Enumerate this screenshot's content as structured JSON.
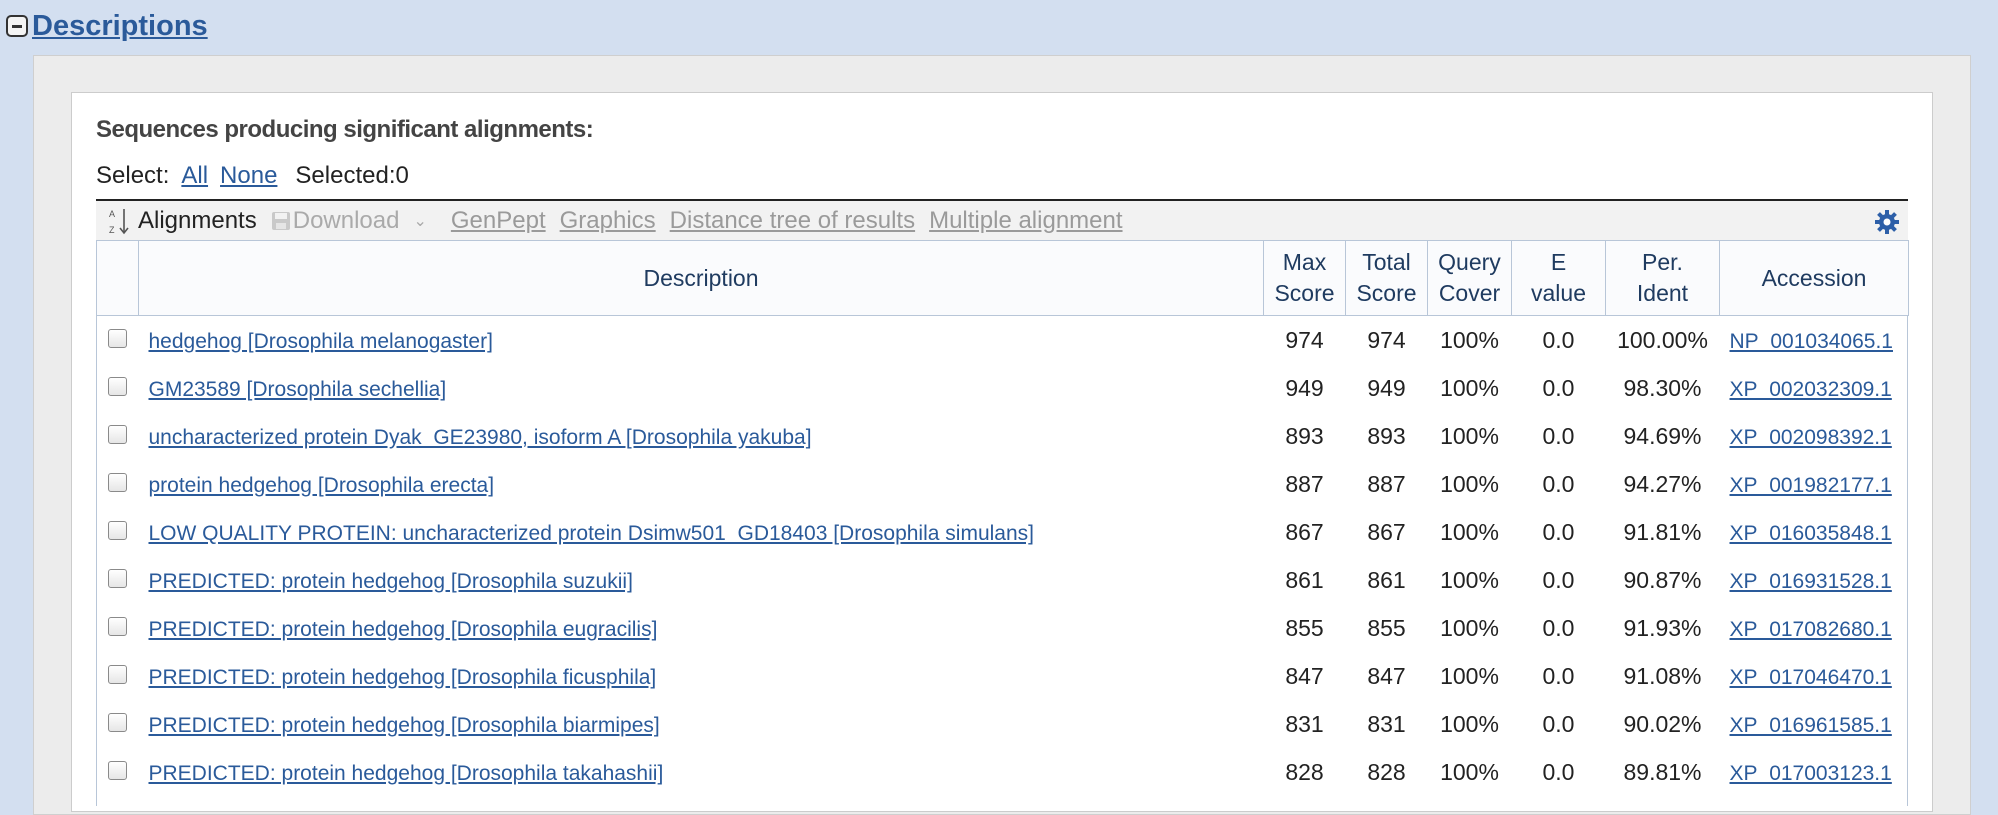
{
  "section": {
    "title": "Descriptions"
  },
  "heading": "Sequences producing significant alignments:",
  "select": {
    "label": "Select:",
    "all": "All",
    "none": "None",
    "selected": "Selected:0"
  },
  "toolbar": {
    "alignments": "Alignments",
    "download": "Download",
    "genpept": "GenPept",
    "graphics": "Graphics",
    "distance_tree": "Distance tree of results",
    "multiple_alignment": "Multiple alignment"
  },
  "columns": {
    "description": "Description",
    "max_score": [
      "Max",
      "Score"
    ],
    "total_score": [
      "Total",
      "Score"
    ],
    "query_cover": [
      "Query",
      "Cover"
    ],
    "e_value": [
      "E",
      "value"
    ],
    "per_ident": [
      "Per.",
      "Ident"
    ],
    "accession": "Accession"
  },
  "rows": [
    {
      "description": "hedgehog [Drosophila melanogaster]",
      "max": "974",
      "total": "974",
      "cover": "100%",
      "evalue": "0.0",
      "ident": "100.00%",
      "accession": "NP_001034065.1"
    },
    {
      "description": "GM23589 [Drosophila sechellia]",
      "max": "949",
      "total": "949",
      "cover": "100%",
      "evalue": "0.0",
      "ident": "98.30%",
      "accession": "XP_002032309.1"
    },
    {
      "description": "uncharacterized protein Dyak_GE23980, isoform A [Drosophila yakuba]",
      "max": "893",
      "total": "893",
      "cover": "100%",
      "evalue": "0.0",
      "ident": "94.69%",
      "accession": "XP_002098392.1"
    },
    {
      "description": "protein hedgehog [Drosophila erecta]",
      "max": "887",
      "total": "887",
      "cover": "100%",
      "evalue": "0.0",
      "ident": "94.27%",
      "accession": "XP_001982177.1"
    },
    {
      "description": "LOW QUALITY PROTEIN: uncharacterized protein Dsimw501_GD18403 [Drosophila simulans]",
      "max": "867",
      "total": "867",
      "cover": "100%",
      "evalue": "0.0",
      "ident": "91.81%",
      "accession": "XP_016035848.1"
    },
    {
      "description": "PREDICTED: protein hedgehog [Drosophila suzukii]",
      "max": "861",
      "total": "861",
      "cover": "100%",
      "evalue": "0.0",
      "ident": "90.87%",
      "accession": "XP_016931528.1"
    },
    {
      "description": "PREDICTED: protein hedgehog [Drosophila eugracilis]",
      "max": "855",
      "total": "855",
      "cover": "100%",
      "evalue": "0.0",
      "ident": "91.93%",
      "accession": "XP_017082680.1"
    },
    {
      "description": "PREDICTED: protein hedgehog [Drosophila ficusphila]",
      "max": "847",
      "total": "847",
      "cover": "100%",
      "evalue": "0.0",
      "ident": "91.08%",
      "accession": "XP_017046470.1"
    },
    {
      "description": "PREDICTED: protein hedgehog [Drosophila biarmipes]",
      "max": "831",
      "total": "831",
      "cover": "100%",
      "evalue": "0.0",
      "ident": "90.02%",
      "accession": "XP_016961585.1"
    },
    {
      "description": "PREDICTED: protein hedgehog [Drosophila takahashii]",
      "max": "828",
      "total": "828",
      "cover": "100%",
      "evalue": "0.0",
      "ident": "89.81%",
      "accession": "XP_017003123.1"
    }
  ],
  "colors": {
    "background": "#d3dff0",
    "link": "#2a5a9a",
    "header_border": "#b8c6d8",
    "gear": "#2d5fa8"
  },
  "icons": {
    "collapse": "minus-box-icon",
    "sort": "sort-icon",
    "download": "disk-icon",
    "settings": "gear-icon"
  }
}
